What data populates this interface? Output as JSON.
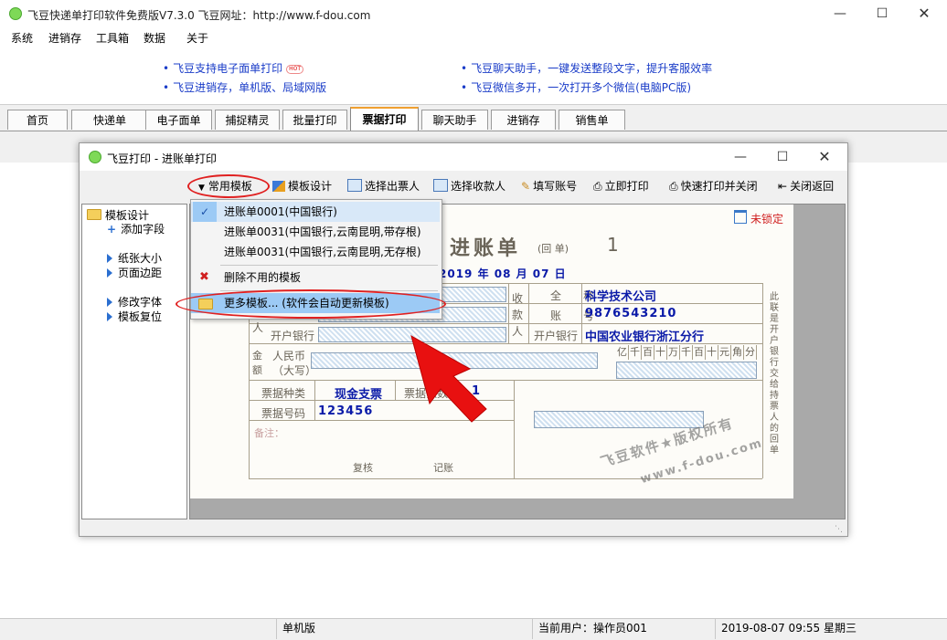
{
  "window": {
    "title": "飞豆快递单打印软件免费版V7.3.0   飞豆网址：http://www.f-dou.com"
  },
  "menu": [
    "系统",
    "进销存",
    "工具箱",
    "数据",
    "关于"
  ],
  "ads": {
    "left": [
      "飞豆支持电子面单打印",
      "飞豆进销存，单机版、局域网版"
    ],
    "hot_badge": "HOT",
    "right": [
      "飞豆聊天助手，一键发送整段文字，提升客服效率",
      "飞豆微信多开，一次打开多个微信(电脑PC版)"
    ]
  },
  "tabs": [
    "首页",
    "快递单",
    "电子面单",
    "捕捉精灵",
    "批量打印",
    "票据打印",
    "聊天助手",
    "进销存",
    "销售单"
  ],
  "active_tab": "票据打印",
  "dialog": {
    "title": "飞豆打印 - 进账单打印",
    "toolbar": [
      "常用模板",
      "模板设计",
      "选择出票人",
      "选择收款人",
      "填写账号",
      "立即打印",
      "快速打印并关闭",
      "关闭返回"
    ],
    "tree": {
      "root": "模板设计",
      "items": [
        "添加字段",
        "纸张大小",
        "页面边距",
        "修改字体",
        "模板复位"
      ]
    },
    "lock_label": "未锁定"
  },
  "dropdown": {
    "items": [
      "进账单0001(中国银行)",
      "进账单0031(中国银行,云南昆明,带存根)",
      "进账单0031(中国银行,云南昆明,无存根)",
      "删除不用的模板",
      "更多模板... (软件会自动更新模板)"
    ]
  },
  "voucher": {
    "title": "进账单",
    "subtitle": "(回   单)",
    "copy_no": "1",
    "date": "2019  年 08 月 07 日",
    "payee_label": "收款人",
    "payee_vertical": [
      "收",
      "款",
      "人"
    ],
    "payer_vertical_tail": "人",
    "fields": {
      "full_name_label": "全　　称",
      "full_name": "科学技术公司",
      "account_label": "账　　号",
      "account": "9876543210",
      "bank_label": "开户银行",
      "bank": "中国农业银行浙江分行",
      "left_bank_label": "开户银行",
      "amount_label": [
        "金",
        "额"
      ],
      "rmb_label": [
        "人民币",
        "（大写）"
      ],
      "digits": [
        "亿",
        "千",
        "百",
        "十",
        "万",
        "千",
        "百",
        "十",
        "元",
        "角",
        "分"
      ],
      "ticket_type_label": "票据种类",
      "ticket_type": "现金支票",
      "ticket_count_label": "票据张数",
      "ticket_count": "1",
      "ticket_no_label": "票据号码",
      "ticket_no": "123456",
      "remark_label": "备注：",
      "review_label": "复核",
      "record_label": "记账",
      "side_note": "此联是开户银行交给持票人的回单"
    },
    "watermark": [
      "飞豆软件★版权所有",
      "www.f-dou.com"
    ]
  },
  "statusbar": {
    "mode": "单机版",
    "user": "当前用户：操作员001",
    "datetime": "2019-08-07 09:55 星期三"
  },
  "colors": {
    "accent_blue": "#1a3cc8",
    "highlight": "#9ccaf5",
    "annotation_red": "#e02020"
  }
}
